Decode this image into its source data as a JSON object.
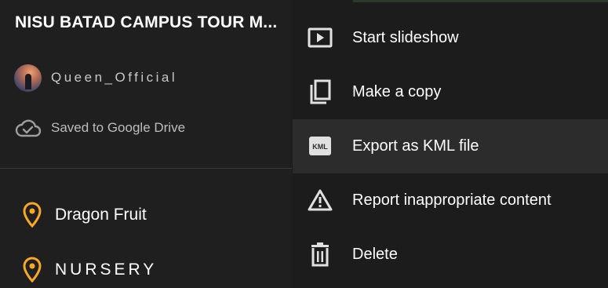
{
  "panel": {
    "title": "NISU BATAD CAMPUS TOUR M...",
    "owner": "Queen_Official",
    "saved_status": "Saved to Google Drive",
    "places": [
      {
        "label": "Dragon Fruit",
        "icon": "map-pin-icon"
      },
      {
        "label": "NURSERY",
        "icon": "map-pin-icon"
      }
    ]
  },
  "menu": {
    "items": [
      {
        "label": "Start slideshow",
        "icon": "slideshow-icon"
      },
      {
        "label": "Make a copy",
        "icon": "copy-icon"
      },
      {
        "label": "Export as KML file",
        "icon": "kml-icon",
        "icon_text": "KML"
      },
      {
        "label": "Report inappropriate content",
        "icon": "warning-icon"
      },
      {
        "label": "Delete",
        "icon": "trash-icon"
      }
    ]
  },
  "colors": {
    "pin": "#f9a825",
    "menu_bg": "#1c1c1c",
    "highlight": "#2c2c2c"
  }
}
